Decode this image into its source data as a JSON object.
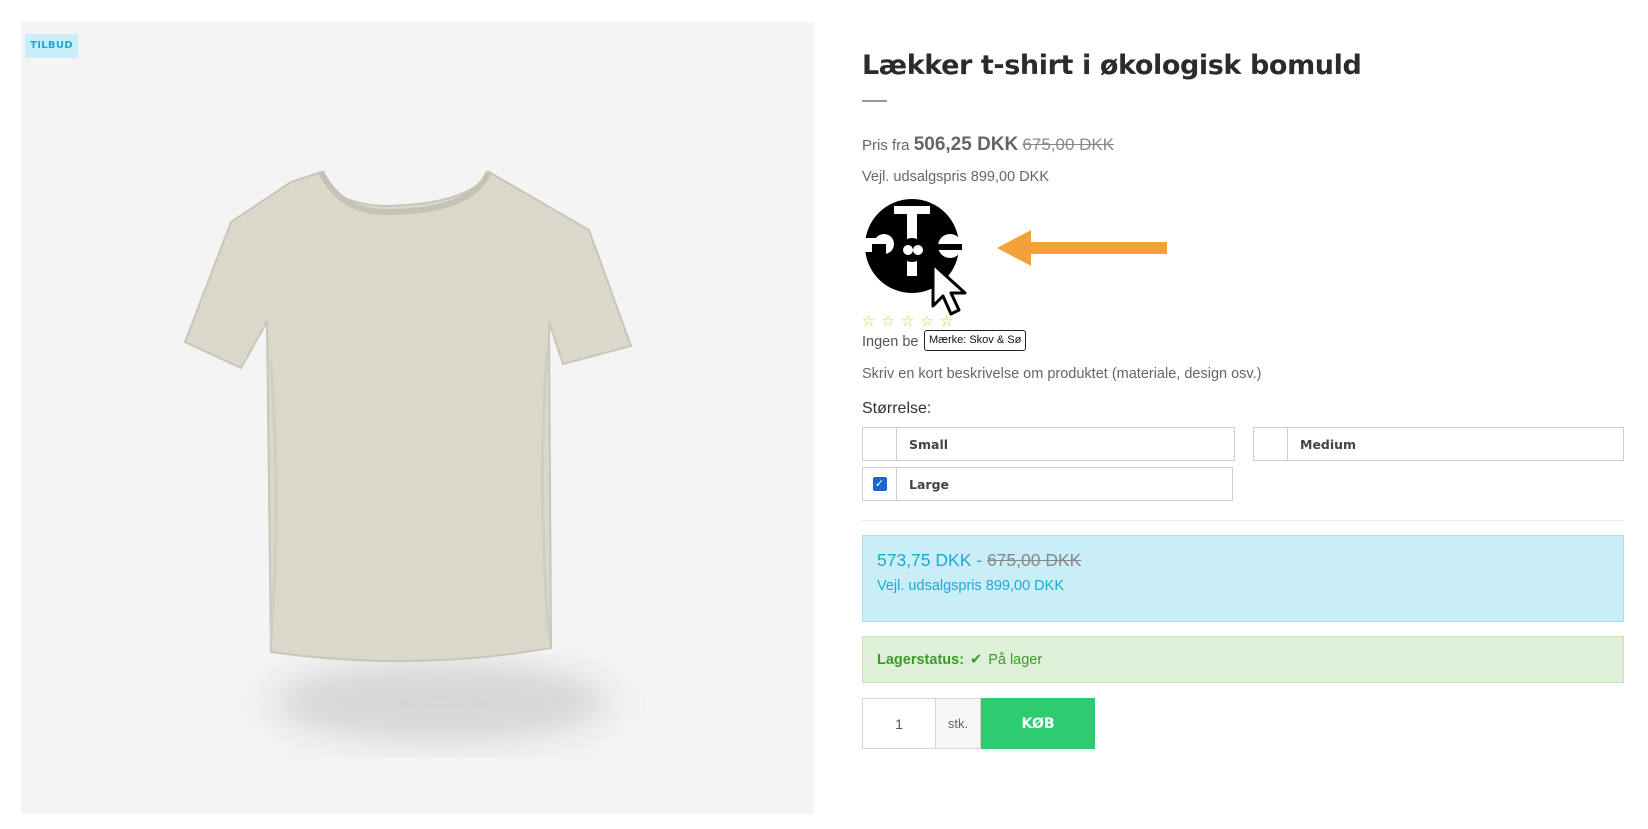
{
  "image": {
    "badge": "TILBUD"
  },
  "product": {
    "title": "Lækker t-shirt i økologisk bomuld",
    "price_prefix": "Pris fra",
    "price": "506,25 DKK",
    "price_old": "675,00 DKK",
    "rrp": "Vejl. udsalgspris 899,00 DKK",
    "brand_tooltip": "Mærke: Skov & Sø",
    "rating": 0,
    "reviews_text": "Ingen be",
    "short_description": "Skriv en kort beskrivelse om produktet (materiale, design osv.)"
  },
  "variants": {
    "label": "Størrelse:",
    "options": [
      {
        "label": "Small",
        "checked": false
      },
      {
        "label": "Medium",
        "checked": false
      },
      {
        "label": "Large",
        "checked": true
      }
    ]
  },
  "selected_price": {
    "price": "573,75 DKK",
    "separator": " - ",
    "price_old": "675,00 DKK",
    "rrp": "Vejl. udsalgspris 899,00 DKK"
  },
  "stock": {
    "label": "Lagerstatus:",
    "value": "På lager"
  },
  "purchase": {
    "quantity": "1",
    "unit": "stk.",
    "buy_label": "KØB"
  },
  "colors": {
    "accent": "#1ba9d4",
    "buy": "#2ecc71",
    "arrow": "#f4a13a",
    "stock": "#3c9a2b",
    "checkbox": "#1b65d3"
  },
  "icons": [
    "star-icon",
    "check-icon",
    "cursor-icon",
    "arrow-icon",
    "checkbox-checked-icon"
  ]
}
